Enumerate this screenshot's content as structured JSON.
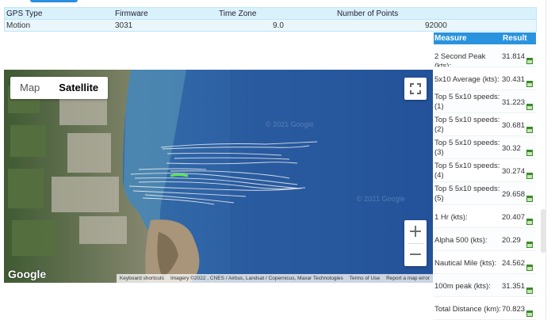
{
  "info": {
    "headers": [
      "GPS Type",
      "Firmware",
      "Time Zone",
      "Number of Points"
    ],
    "values": [
      "Motion",
      "3031",
      "9.0",
      "92000"
    ]
  },
  "map": {
    "type_control": {
      "map_label": "Map",
      "satellite_label": "Satellite",
      "selected": "Satellite"
    },
    "zoom_in_label": "+",
    "zoom_out_label": "−",
    "logo": "Google",
    "watermark": "© 2021 Google",
    "attribution": [
      "Keyboard shortcuts",
      "Imagery ©2022 , CNES / Airbus, Landsat / Copernicus, Maxar Technologies",
      "Terms of Use",
      "Report a map error"
    ],
    "colors": {
      "water": "#2d5fa0",
      "track": "#f2f2f2",
      "highlight": "#5fe35f"
    }
  },
  "stats": {
    "headers": {
      "measure": "Measure",
      "result": "Result"
    },
    "rows": [
      {
        "label": "2 Second Peak (kts):",
        "value": "31.814"
      },
      {
        "label": "5x10 Average (kts):",
        "value": "30.431"
      },
      {
        "label": "Top 5 5x10 speeds: (1)",
        "value": "31.223"
      },
      {
        "label": "Top 5 5x10 speeds: (2)",
        "value": "30.681"
      },
      {
        "label": "Top 5 5x10 speeds: (3)",
        "value": "30.32"
      },
      {
        "label": "Top 5 5x10 speeds: (4)",
        "value": "30.274"
      },
      {
        "label": "Top 5 5x10 speeds: (5)",
        "value": "29.658"
      },
      {
        "label": "1 Hr (kts):",
        "value": "20.407"
      },
      {
        "label": "Alpha 500 (kts):",
        "value": "20.29"
      },
      {
        "label": "Nautical Mile (kts):",
        "value": "24.562"
      },
      {
        "label": "100m peak (kts):",
        "value": "31.351"
      },
      {
        "label": "Total Distance (km):",
        "value": "70.823"
      }
    ]
  }
}
